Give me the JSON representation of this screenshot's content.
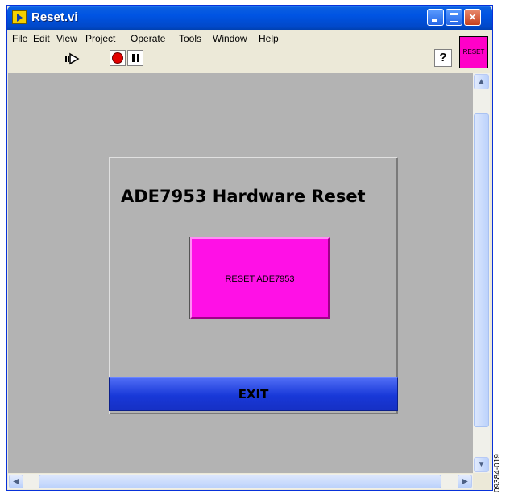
{
  "window": {
    "title": "Reset.vi",
    "icon": "labview-vi-icon",
    "controls": {
      "minimize": "minimize-icon",
      "maximize": "maximize-icon",
      "close": "×"
    }
  },
  "menu": [
    {
      "accel": "F",
      "rest": "ile"
    },
    {
      "accel": "E",
      "rest": "dit"
    },
    {
      "accel": "V",
      "rest": "iew"
    },
    {
      "accel": "P",
      "rest": "roject"
    },
    {
      "accel": "O",
      "rest": "perate"
    },
    {
      "accel": "T",
      "rest": "ools"
    },
    {
      "accel": "W",
      "rest": "indow"
    },
    {
      "accel": "H",
      "rest": "elp"
    }
  ],
  "toolbar": {
    "run": "run-arrow-icon",
    "abort": "abort-stop-icon",
    "pause": "pause-icon",
    "help": "?"
  },
  "vi_icon_label": "RESET",
  "front_panel": {
    "heading": "ADE7953 Hardware Reset",
    "reset_button": "RESET ADE7953",
    "exit_button": "EXIT"
  },
  "scroll": {
    "up": "▲",
    "down": "▼",
    "left": "◀",
    "right": "▶"
  },
  "figure_id": "09384-019",
  "colors": {
    "panel": "#b3b3b3",
    "reset_button": "#ff10e6",
    "exit_button": "#1838d8",
    "titlebar": "#0054e3"
  }
}
